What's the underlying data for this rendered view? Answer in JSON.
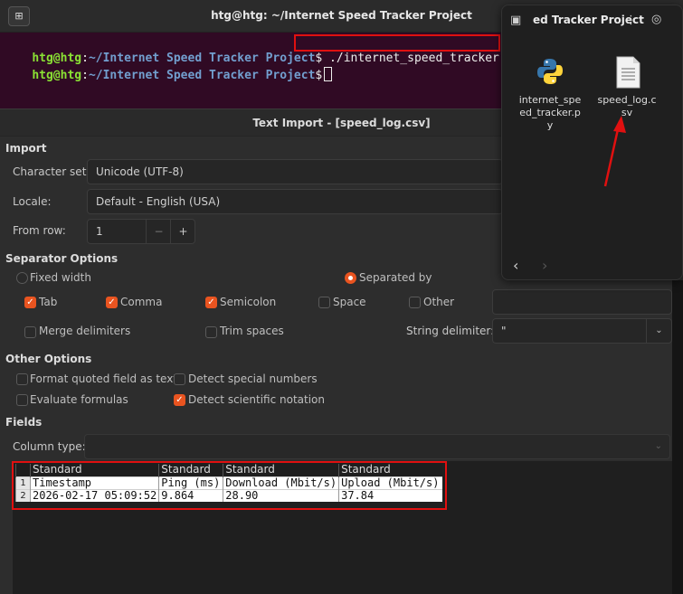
{
  "terminal": {
    "title": "htg@htg: ~/Internet Speed Tracker Project",
    "new_tab_icon": "new-tab-icon",
    "lines": [
      {
        "user": "htg@htg",
        "sep": ":",
        "path": "~/Internet Speed Tracker Project",
        "dollar": "$",
        "cmd": " ./internet_speed_tracker.py"
      },
      {
        "user": "htg@htg",
        "sep": ":",
        "path": "~/Internet Speed Tracker Project",
        "dollar": "$",
        "cmd": " "
      }
    ]
  },
  "dialog": {
    "title": "Text Import - [speed_log.csv]",
    "import": {
      "heading": "Import",
      "charset_label": "Character set:",
      "charset_value": "Unicode (UTF-8)",
      "locale_label": "Locale:",
      "locale_value": "Default - English (USA)",
      "fromrow_label": "From row:",
      "fromrow_value": "1",
      "minus": "−",
      "plus": "+"
    },
    "separator": {
      "heading": "Separator Options",
      "fixed_width": "Fixed width",
      "separated_by": "Separated by",
      "tab": "Tab",
      "comma": "Comma",
      "semicolon": "Semicolon",
      "space": "Space",
      "other": "Other",
      "merge": "Merge delimiters",
      "trim": "Trim spaces",
      "string_delim_label": "String delimiter:",
      "string_delim_value": "\""
    },
    "other_options": {
      "heading": "Other Options",
      "format_quoted": "Format quoted field as text",
      "detect_special": "Detect special numbers",
      "evaluate": "Evaluate formulas",
      "detect_sci": "Detect scientific notation"
    },
    "fields": {
      "heading": "Fields",
      "column_type_label": "Column type:",
      "column_type_value": "",
      "types": [
        "Standard",
        "Standard",
        "Standard",
        "Standard"
      ],
      "rows": [
        {
          "num": "1",
          "cells": [
            "Timestamp",
            "Ping (ms)",
            "Download (Mbit/s)",
            "Upload (Mbit/s)"
          ]
        },
        {
          "num": "2",
          "cells": [
            "2026-02-17 05:09:52",
            "9.864",
            "28.90",
            "37.84"
          ]
        }
      ]
    }
  },
  "files": {
    "title": "ed Tracker Project",
    "items": [
      {
        "name": "internet_speed_tracker.py",
        "lines": [
          "internet_spe",
          "ed_tracker.p",
          "y"
        ],
        "icon": "python-file-icon"
      },
      {
        "name": "speed_log.csv",
        "lines": [
          "speed_log.c",
          "sv"
        ],
        "icon": "text-file-icon"
      }
    ],
    "back": "‹",
    "forward": "›"
  },
  "colors": {
    "accent": "#e95420",
    "highlight": "#e01010",
    "terminal_bg": "#300a24"
  }
}
